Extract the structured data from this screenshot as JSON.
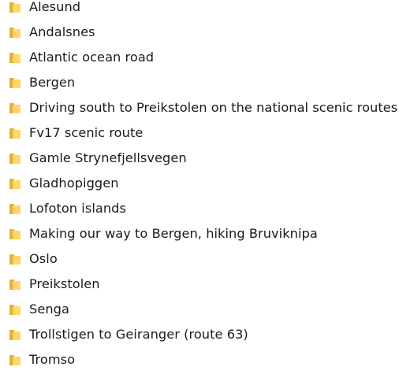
{
  "folders": [
    {
      "name": "Alesund",
      "icon": "folder-icon"
    },
    {
      "name": "Andalsnes",
      "icon": "folder-icon"
    },
    {
      "name": "Atlantic ocean road",
      "icon": "folder-icon"
    },
    {
      "name": "Bergen",
      "icon": "folder-icon"
    },
    {
      "name": "Driving south to Preikstolen on the national scenic routes",
      "icon": "folder-icon"
    },
    {
      "name": "Fv17 scenic route",
      "icon": "folder-icon"
    },
    {
      "name": "Gamle Strynefjellsvegen",
      "icon": "folder-icon"
    },
    {
      "name": "Gladhopiggen",
      "icon": "folder-icon"
    },
    {
      "name": "Lofoton islands",
      "icon": "folder-icon"
    },
    {
      "name": "Making our way to Bergen, hiking Bruviknipa",
      "icon": "folder-icon"
    },
    {
      "name": "Oslo",
      "icon": "folder-icon"
    },
    {
      "name": "Preikstolen",
      "icon": "folder-icon"
    },
    {
      "name": "Senga",
      "icon": "folder-icon"
    },
    {
      "name": "Trollstigen to Geiranger (route 63)",
      "icon": "folder-icon"
    },
    {
      "name": "Tromso",
      "icon": "folder-icon"
    }
  ],
  "colors": {
    "folder_back": "#e4b03d",
    "folder_front": "#ffd867",
    "text": "#1a1a1a",
    "background": "#ffffff"
  }
}
